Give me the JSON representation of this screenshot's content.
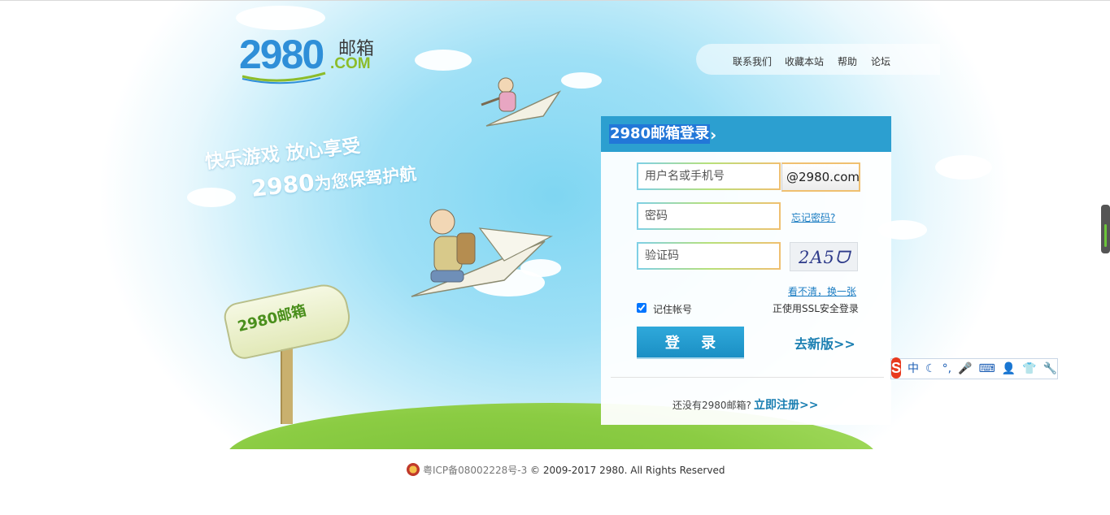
{
  "logo": {
    "number": "2980",
    "cn": "邮箱",
    "com": ".COM"
  },
  "topnav": {
    "items": [
      {
        "label": "联系我们"
      },
      {
        "label": "收藏本站"
      },
      {
        "label": "帮助"
      },
      {
        "label": "论坛"
      }
    ]
  },
  "slogan": {
    "line1": "快乐游戏  放心享受",
    "line2_num": "2980",
    "line2_text": "为您保驾护航"
  },
  "mailbox": {
    "label": "2980邮箱"
  },
  "login": {
    "title": "2980邮箱登录",
    "username_placeholder": "用户名或手机号",
    "domain_suffix": "@2980.com",
    "password_placeholder": "密码",
    "forgot_password": "忘记密码?",
    "captcha_placeholder": "验证码",
    "captcha_text": "2A5ᗜ",
    "captcha_refresh": "看不清，换一张",
    "remember_label": "记住帐号",
    "remember_checked": true,
    "ssl_text": "正使用SSL安全登录",
    "submit_label": "登 录",
    "new_version": "去新版>>",
    "no_account": "还没有2980邮箱?",
    "register": "立即注册>>"
  },
  "ime": {
    "logo": "S",
    "items": [
      "中",
      "☾",
      "°,",
      "🎤",
      "⌨",
      "👤",
      "👕",
      "🔧"
    ],
    "brand_color": "#e8391e"
  },
  "footer": {
    "icp": "粤ICP备08002228号-3",
    "copyright": "© 2009-2017 2980. All Rights Reserved"
  },
  "colors": {
    "accent": "#2c9fd0",
    "link": "#1b7fb2",
    "title_highlight": "#2277d8",
    "grass": "#8bcc43"
  }
}
